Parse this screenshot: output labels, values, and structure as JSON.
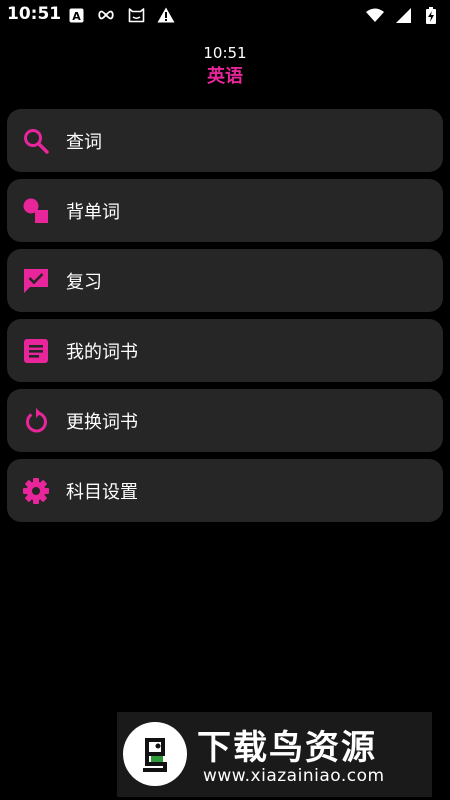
{
  "status_bar": {
    "time": "10:51",
    "icons_left": [
      "a-notification-icon",
      "infinity-icon",
      "cat-icon",
      "warning-icon"
    ],
    "icons_right": [
      "wifi-icon",
      "signal-icon",
      "battery-charging-icon"
    ]
  },
  "header": {
    "time": "10:51",
    "title": "英语"
  },
  "menu": {
    "items": [
      {
        "label": "查词",
        "icon": "search-icon"
      },
      {
        "label": "背单词",
        "icon": "shapes-icon"
      },
      {
        "label": "复习",
        "icon": "checked-chat-icon"
      },
      {
        "label": "我的词书",
        "icon": "note-icon"
      },
      {
        "label": "更换词书",
        "icon": "refresh-icon"
      },
      {
        "label": "科目设置",
        "icon": "gear-icon"
      }
    ]
  },
  "watermark": {
    "title": "下载鸟资源",
    "url": "www.xiazainiao.com"
  },
  "colors": {
    "accent": "#e8259a",
    "background": "#000000",
    "card": "#262626"
  }
}
